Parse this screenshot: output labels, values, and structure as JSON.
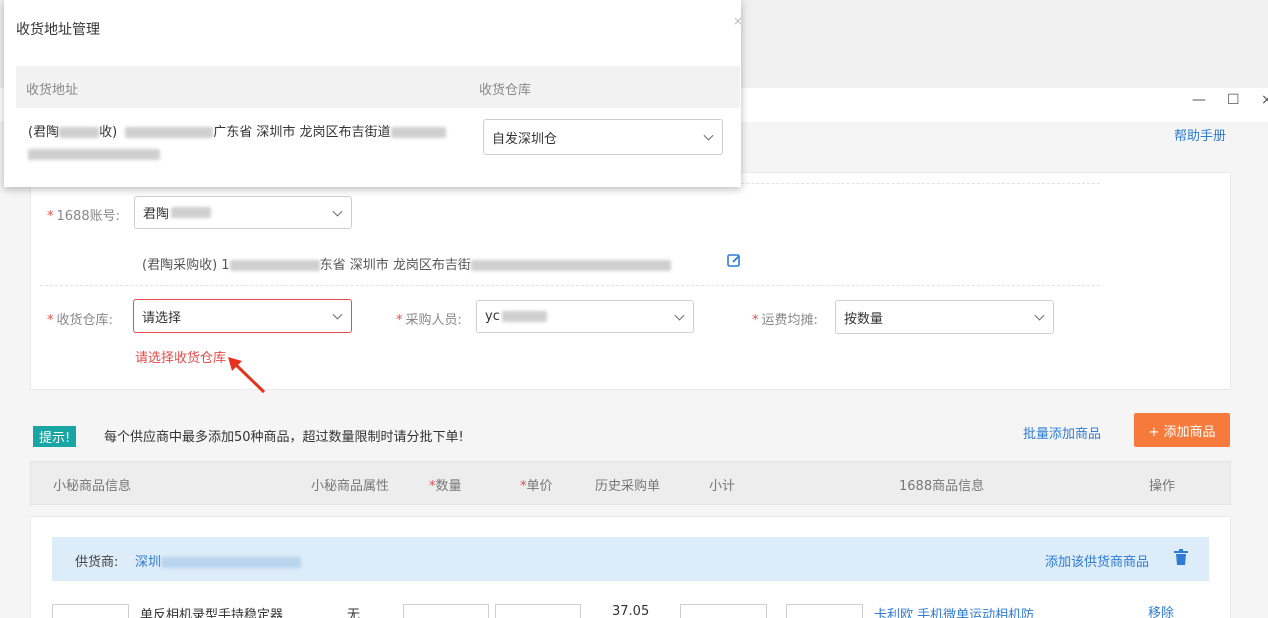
{
  "modal": {
    "title": "收货地址管理",
    "close": "×",
    "columns": [
      "收货地址",
      "收货仓库"
    ],
    "address_line1_a": "(君陶",
    "address_line1_b": "收)",
    "address_line1_c": "广东省 深圳市 龙岗区布吉街道",
    "warehouse_value": "自发深圳仓"
  },
  "window": {
    "minimize": "—",
    "maximize": "☐",
    "close": "×"
  },
  "header": {
    "help_link": "帮助手册"
  },
  "form": {
    "account_label": "1688账号:",
    "account_value": "君陶",
    "address_a": "(君陶采购收) 1",
    "address_b": "东省 深圳市 龙岗区布吉街",
    "warehouse_label": "收货仓库:",
    "warehouse_placeholder": "请选择",
    "warehouse_error": "请选择收货仓库",
    "buyer_label": "采购人员:",
    "buyer_value": "yc",
    "freight_label": "运费均摊:",
    "freight_value": "按数量"
  },
  "tip": {
    "badge": "提示!",
    "text": "每个供应商中最多添加50种商品，超过数量限制时请分批下单!",
    "batch_add": "批量添加商品",
    "add_button": "+ 添加商品"
  },
  "table": {
    "headers": {
      "info": "小秘商品信息",
      "attr": "小秘商品属性",
      "qty": "数量",
      "price": "单价",
      "history": "历史采购单",
      "subtotal": "小计",
      "info1688": "1688商品信息",
      "ops": "操作"
    },
    "supplier_label": "供货商:",
    "supplier_name": "深圳",
    "supplier_add": "添加该供货商商品",
    "row": {
      "product": "单反相机录型手持稳定器",
      "attr": "无",
      "subtotal": "37.05",
      "link": "卡利欧 手机微单运动相机防",
      "remove": "移除"
    }
  }
}
